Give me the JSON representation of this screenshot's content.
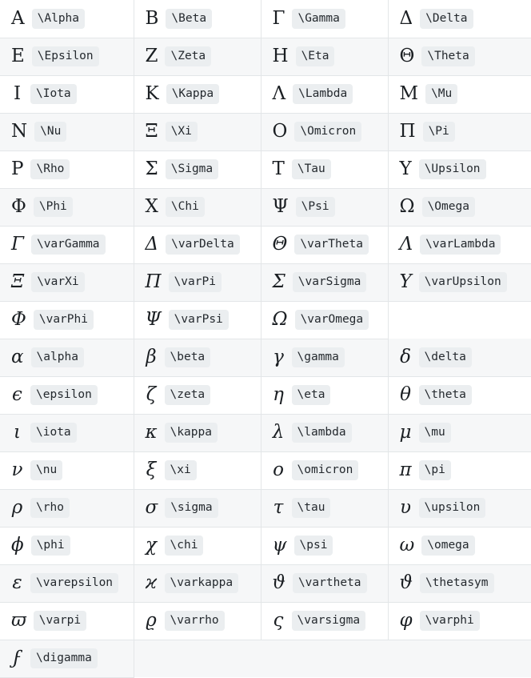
{
  "page": {
    "title": "Greek letters LaTeX command reference table",
    "columns": 4,
    "rows": 18,
    "colors": {
      "page_background": "#ffffff",
      "row_stripe": "#f6f7f8",
      "grid_line": "#e3e6e8",
      "code_background": "#ebeef0",
      "text": "#24292e"
    }
  },
  "table": {
    "rows": [
      {
        "cells": [
          {
            "glyph": "Α",
            "command": "\\Alpha",
            "italic": false
          },
          {
            "glyph": "Β",
            "command": "\\Beta",
            "italic": false
          },
          {
            "glyph": "Γ",
            "command": "\\Gamma",
            "italic": false
          },
          {
            "glyph": "Δ",
            "command": "\\Delta",
            "italic": false
          }
        ]
      },
      {
        "cells": [
          {
            "glyph": "Ε",
            "command": "\\Epsilon",
            "italic": false
          },
          {
            "glyph": "Ζ",
            "command": "\\Zeta",
            "italic": false
          },
          {
            "glyph": "Η",
            "command": "\\Eta",
            "italic": false
          },
          {
            "glyph": "Θ",
            "command": "\\Theta",
            "italic": false
          }
        ]
      },
      {
        "cells": [
          {
            "glyph": "Ι",
            "command": "\\Iota",
            "italic": false
          },
          {
            "glyph": "Κ",
            "command": "\\Kappa",
            "italic": false
          },
          {
            "glyph": "Λ",
            "command": "\\Lambda",
            "italic": false
          },
          {
            "glyph": "Μ",
            "command": "\\Mu",
            "italic": false
          }
        ]
      },
      {
        "cells": [
          {
            "glyph": "Ν",
            "command": "\\Nu",
            "italic": false
          },
          {
            "glyph": "Ξ",
            "command": "\\Xi",
            "italic": false
          },
          {
            "glyph": "Ο",
            "command": "\\Omicron",
            "italic": false
          },
          {
            "glyph": "Π",
            "command": "\\Pi",
            "italic": false
          }
        ]
      },
      {
        "cells": [
          {
            "glyph": "Ρ",
            "command": "\\Rho",
            "italic": false
          },
          {
            "glyph": "Σ",
            "command": "\\Sigma",
            "italic": false
          },
          {
            "glyph": "Τ",
            "command": "\\Tau",
            "italic": false
          },
          {
            "glyph": "Υ",
            "command": "\\Upsilon",
            "italic": false
          }
        ]
      },
      {
        "cells": [
          {
            "glyph": "Φ",
            "command": "\\Phi",
            "italic": false
          },
          {
            "glyph": "Χ",
            "command": "\\Chi",
            "italic": false
          },
          {
            "glyph": "Ψ",
            "command": "\\Psi",
            "italic": false
          },
          {
            "glyph": "Ω",
            "command": "\\Omega",
            "italic": false
          }
        ]
      },
      {
        "cells": [
          {
            "glyph": "Γ",
            "command": "\\varGamma",
            "italic": true
          },
          {
            "glyph": "Δ",
            "command": "\\varDelta",
            "italic": true
          },
          {
            "glyph": "Θ",
            "command": "\\varTheta",
            "italic": true
          },
          {
            "glyph": "Λ",
            "command": "\\varLambda",
            "italic": true
          }
        ]
      },
      {
        "cells": [
          {
            "glyph": "Ξ",
            "command": "\\varXi",
            "italic": true
          },
          {
            "glyph": "Π",
            "command": "\\varPi",
            "italic": true
          },
          {
            "glyph": "Σ",
            "command": "\\varSigma",
            "italic": true
          },
          {
            "glyph": "Υ",
            "command": "\\varUpsilon",
            "italic": true
          }
        ]
      },
      {
        "cells": [
          {
            "glyph": "Φ",
            "command": "\\varPhi",
            "italic": true
          },
          {
            "glyph": "Ψ",
            "command": "\\varPsi",
            "italic": true
          },
          {
            "glyph": "Ω",
            "command": "\\varOmega",
            "italic": true
          },
          {
            "glyph": "",
            "command": "",
            "italic": false,
            "blank": true
          }
        ]
      },
      {
        "cells": [
          {
            "glyph": "α",
            "command": "\\alpha",
            "italic": true
          },
          {
            "glyph": "β",
            "command": "\\beta",
            "italic": true
          },
          {
            "glyph": "γ",
            "command": "\\gamma",
            "italic": true
          },
          {
            "glyph": "δ",
            "command": "\\delta",
            "italic": true
          }
        ]
      },
      {
        "cells": [
          {
            "glyph": "ϵ",
            "command": "\\epsilon",
            "italic": true
          },
          {
            "glyph": "ζ",
            "command": "\\zeta",
            "italic": true
          },
          {
            "glyph": "η",
            "command": "\\eta",
            "italic": true
          },
          {
            "glyph": "θ",
            "command": "\\theta",
            "italic": true
          }
        ]
      },
      {
        "cells": [
          {
            "glyph": "ι",
            "command": "\\iota",
            "italic": true
          },
          {
            "glyph": "κ",
            "command": "\\kappa",
            "italic": true
          },
          {
            "glyph": "λ",
            "command": "\\lambda",
            "italic": true
          },
          {
            "glyph": "μ",
            "command": "\\mu",
            "italic": true
          }
        ]
      },
      {
        "cells": [
          {
            "glyph": "ν",
            "command": "\\nu",
            "italic": true
          },
          {
            "glyph": "ξ",
            "command": "\\xi",
            "italic": true
          },
          {
            "glyph": "ο",
            "command": "\\omicron",
            "italic": true
          },
          {
            "glyph": "π",
            "command": "\\pi",
            "italic": true
          }
        ]
      },
      {
        "cells": [
          {
            "glyph": "ρ",
            "command": "\\rho",
            "italic": true
          },
          {
            "glyph": "σ",
            "command": "\\sigma",
            "italic": true
          },
          {
            "glyph": "τ",
            "command": "\\tau",
            "italic": true
          },
          {
            "glyph": "υ",
            "command": "\\upsilon",
            "italic": true
          }
        ]
      },
      {
        "cells": [
          {
            "glyph": "ϕ",
            "command": "\\phi",
            "italic": true
          },
          {
            "glyph": "χ",
            "command": "\\chi",
            "italic": true
          },
          {
            "glyph": "ψ",
            "command": "\\psi",
            "italic": true
          },
          {
            "glyph": "ω",
            "command": "\\omega",
            "italic": true
          }
        ]
      },
      {
        "cells": [
          {
            "glyph": "ε",
            "command": "\\varepsilon",
            "italic": true
          },
          {
            "glyph": "ϰ",
            "command": "\\varkappa",
            "italic": true
          },
          {
            "glyph": "ϑ",
            "command": "\\vartheta",
            "italic": true
          },
          {
            "glyph": "ϑ",
            "command": "\\thetasym",
            "italic": true
          }
        ]
      },
      {
        "cells": [
          {
            "glyph": "ϖ",
            "command": "\\varpi",
            "italic": true
          },
          {
            "glyph": "ϱ",
            "command": "\\varrho",
            "italic": true
          },
          {
            "glyph": "ς",
            "command": "\\varsigma",
            "italic": true
          },
          {
            "glyph": "φ",
            "command": "\\varphi",
            "italic": true
          }
        ]
      },
      {
        "cells": [
          {
            "glyph": "ϝ",
            "command": "\\digamma",
            "italic": true
          },
          {
            "glyph": "",
            "command": "",
            "italic": false,
            "blank": true
          },
          {
            "glyph": "",
            "command": "",
            "italic": false,
            "blank": true
          },
          {
            "glyph": "",
            "command": "",
            "italic": false,
            "blank": true
          }
        ]
      }
    ]
  }
}
